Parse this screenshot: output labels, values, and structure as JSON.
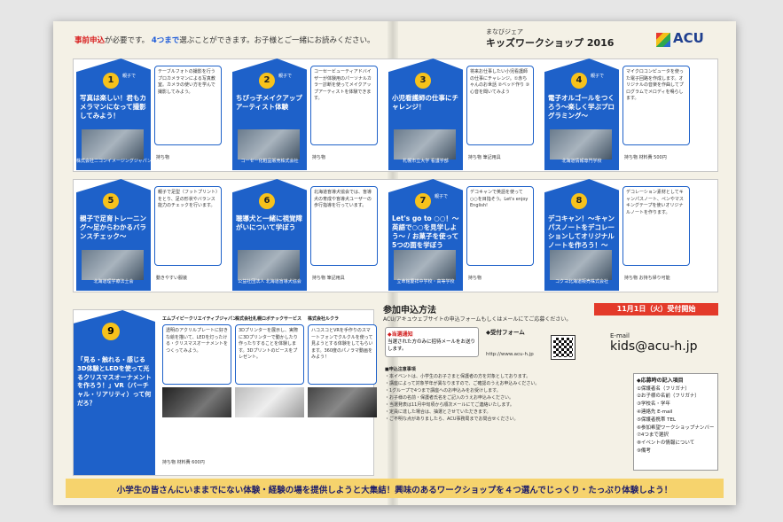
{
  "header": {
    "note_a": "事前申込",
    "note_b": "が必要です。",
    "note_c": "4つまで",
    "note_d": "選ぶことができます。お子様とご一緒にお読みください。",
    "ws_sub": "まなびジェア",
    "ws_title": "キッズワークショップ 2016",
    "logo": "ACU"
  },
  "cards": [
    {
      "num": "1",
      "tag": "親子で",
      "title": "写真は楽しい！君もカメラマンになって撮影してみよう！",
      "org": "株式会社ニコンイメージングジャパン",
      "desc": "テーブルフォトの撮影を行うプロカメラマンによる写真教室。カメラの使い方を学んで撮影してみよう。",
      "mat": "持ち物"
    },
    {
      "num": "2",
      "tag": "親子で",
      "title": "ちびっ子メイクアップアーティスト体験",
      "org": "コーセー化粧品販売株式会社",
      "desc": "コーセービューティアドバイザーが体験用のパーソナルカラー診断を使ってメイクアップアーティストを体験できます。",
      "mat": "持ち物"
    },
    {
      "num": "3",
      "tag": "",
      "title": "小児看護師の仕事にチャレンジ！",
      "org": "札幌市立大学 看護学部",
      "desc": "将来お仕事したい小児看護師の仕事にチャレンジ。①赤ちゃんのお世話 ②ベッド作り ③心音を聞いてみよう",
      "mat": "持ち物 筆記用具"
    },
    {
      "num": "4",
      "tag": "親子で",
      "title": "電子オルゴールをつくろう～楽しく学ぶプログラミング～",
      "org": "北海道情報専門学校",
      "desc": "マイクロコンピュータを使った電子回路を作成します。オリジナルの音楽を作曲してプログラムでメロディを鳴らします。",
      "mat": "持ち物 材料費 500円"
    },
    {
      "num": "5",
      "tag": "",
      "title": "親子で足育トレーニング～足からわかるバランスチェック～",
      "org": "北海道理学療法士会",
      "desc": "親子で足型（フットプリント）をとり、足の形状やバランス能力のチェックを行います。",
      "mat": "動きやすい服装"
    },
    {
      "num": "6",
      "tag": "",
      "title": "聴導犬と一緒に視覚障がいについて学ぼう",
      "org": "公益社団法人 北海道盲導犬協会",
      "desc": "北海道盲導犬協会では、盲導犬の育成や盲導犬ユーザーの歩行指導を行っています。",
      "mat": "持ち物 筆記用具"
    },
    {
      "num": "7",
      "tag": "親子で",
      "title": "Let's go to ○○！～英語で○○を見学しよう～ / お菓子を使って5つの面を学ぼう",
      "org": "立命館慶祥中学校・高等学校",
      "desc": "デコキャンで英語を使って○○を目指そう。Let's enjoy English!",
      "mat": "持ち物"
    },
    {
      "num": "8",
      "tag": "",
      "title": "デコキャン！～キャンパスノートをデコレーションしてオリジナルノートを作ろう！～",
      "org": "コクヨ北海道販売株式会社",
      "desc": "デコレーション素材としてキャンパスノート、ペンやマスキングテープを使いオリジナルノートを作ります。",
      "mat": "持ち物 お持ち帰り可能"
    }
  ],
  "card9": {
    "num": "9",
    "title": "「見る・触れる・感じる 3D体験とLEDを使って光るクリスマスオーナメントを作ろう！」VR（バーチャル・リアリティ）って何だろ？",
    "mat": "持ち物 材料費 600円",
    "subs": [
      {
        "name": "エムブイピークリエイティブジャパン",
        "desc": "透明のアクリルプレートに好きな絵を描いて、LEDを灯ったける・クリスマスオーナメントをつくってみよう。"
      },
      {
        "name": "株式会社札幌ロボテックサービス",
        "desc": "3Dプリンターを展示し、実際に3Dプリンターで動かしたり作ったりすることを体験します。3Dプリントのピースをプレゼント。"
      },
      {
        "name": "株式会社ルクラ",
        "desc": "ハコスコとVRを手作りのスマートフォンでクルクルを使って見ようとする体験をしてもらいます。360度のパノラマ動画をみよう！"
      }
    ]
  },
  "apply": {
    "title": "参加申込方法",
    "sub": "ACU/アキュウェブサイトの申込フォームもしくはメールにてご応募ください。",
    "deadline": "11月1日（火）受付開始",
    "web_h": "◆当選通知",
    "web_t": "当選された方のみに招待メールをお送りします。",
    "form": "◆受付フォーム",
    "url": "http://www.acu-h.jp",
    "email_lbl": "E-mail",
    "email": "kids@acu-h.jp",
    "notes_h": "■申込注意事項",
    "notes": [
      "・本イベントは、小学生のお子さまと保護者の方を対象としております。",
      "・講座によって対象学年が異なりますので、ご確認のうえお申込みください。",
      "・1グループで4つまで講座へのお申込みをお受けします。",
      "・お子様の名前・保護者氏名をご記入のうえお申込みください。",
      "・当選発表は11月中旬頃から順次メールにてご連絡いたします。",
      "・定員に達した場合は、抽選とさせていただきます。",
      "・ご不明な点がありましたら、ACU事務局までお問合せください。"
    ],
    "req_h": "◆応募時の記入項目",
    "req": [
      "①保護者名（フリガナ）",
      "②お子様の名前（フリガナ）",
      "③学校名・学年",
      "④連絡先 E-mail",
      "⑤保護者携帯 TEL",
      "⑥参加希望ワークショップナンバー",
      "⑦4つまで選択",
      "⑧イベントの情報について",
      "⑨備考"
    ]
  },
  "bottom_text": "小学生の皆さんにいままでにない体験・経験の場を提供しようと大集結！興味のあるワークショップを４つ選んでじっくり・たっぷり体験しよう！"
}
